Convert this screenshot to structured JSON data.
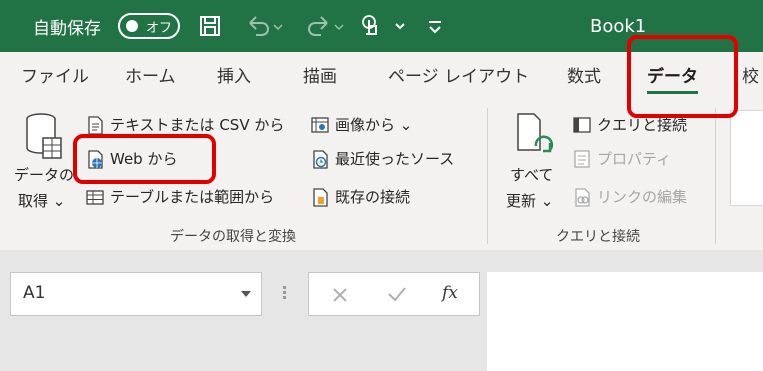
{
  "titlebar": {
    "autosave_label": "自動保存",
    "toggle_label": "オフ",
    "book_title": "Book1"
  },
  "tabs": [
    "ファイル",
    "ホーム",
    "挿入",
    "描画",
    "ページ レイアウト",
    "数式",
    "データ",
    "校"
  ],
  "active_tab": "データ",
  "groups": {
    "get_data": {
      "label": "データの取得と変換",
      "big_button_label_1": "データの",
      "big_button_label_2": "取得 ⌄",
      "text_csv": "テキストまたは CSV から",
      "web": "Web から",
      "table_range": "テーブルまたは範囲から",
      "from_picture": "画像から ⌄",
      "recent_sources": "最近使ったソース",
      "existing_connections": "既存の接続"
    },
    "queries": {
      "label": "クエリと接続",
      "refresh_label_1": "すべて",
      "refresh_label_2": "更新 ⌄",
      "queries_connections": "クエリと接続",
      "properties": "プロパティ",
      "edit_links": "リンクの編集"
    }
  },
  "formula_bar": {
    "name_box": "A1",
    "fx": "fx"
  },
  "colors": {
    "brand_green": "#217346",
    "highlight_red": "#e00000"
  },
  "icons": [
    "save-icon",
    "undo-icon",
    "redo-icon",
    "touch-mode-icon",
    "customize-qat-icon",
    "database-icon",
    "text-file-icon",
    "web-icon",
    "table-icon",
    "picture-icon",
    "clock-icon",
    "connection-icon",
    "refresh-icon",
    "query-panel-icon",
    "properties-icon",
    "link-edit-icon"
  ]
}
